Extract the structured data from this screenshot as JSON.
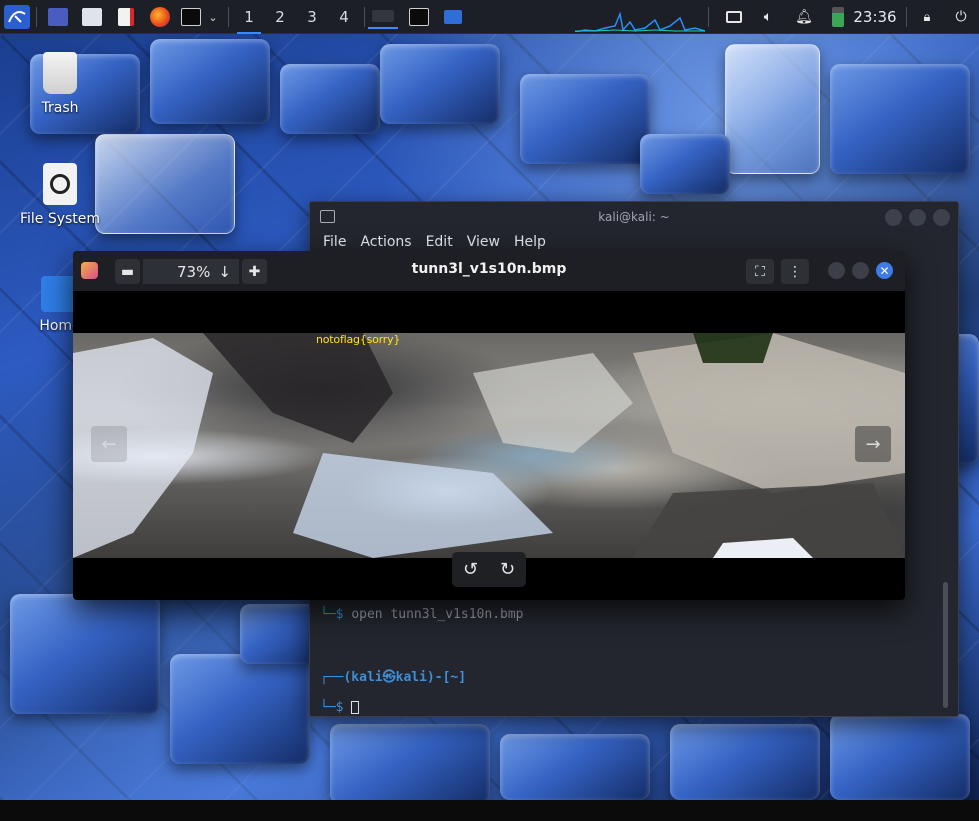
{
  "taskbar": {
    "workspaces": [
      "1",
      "2",
      "3",
      "4"
    ],
    "active_workspace": "1",
    "clock": "23:36",
    "accent_color": "#3b8bff"
  },
  "desktop": {
    "icons": [
      {
        "label": "Trash",
        "icon": "trash-icon"
      },
      {
        "label": "File System",
        "icon": "drive-icon"
      },
      {
        "label": "Home",
        "icon": "home-folder-icon"
      }
    ]
  },
  "terminal": {
    "title": "kali@kali: ~",
    "menu": [
      "File",
      "Actions",
      "Edit",
      "View",
      "Help"
    ],
    "lines": {
      "cmd_prefix": "└─$ ",
      "cmd": "open tunn3l_v1s10n.bmp",
      "prompt_top": "┌──(kali㉿kali)-[~]",
      "prompt_bottom": "└─$ "
    }
  },
  "viewer": {
    "title": "tunn3l_v1s10n.bmp",
    "zoom": "73%",
    "overlay_text": "notoflag{sorry}"
  }
}
